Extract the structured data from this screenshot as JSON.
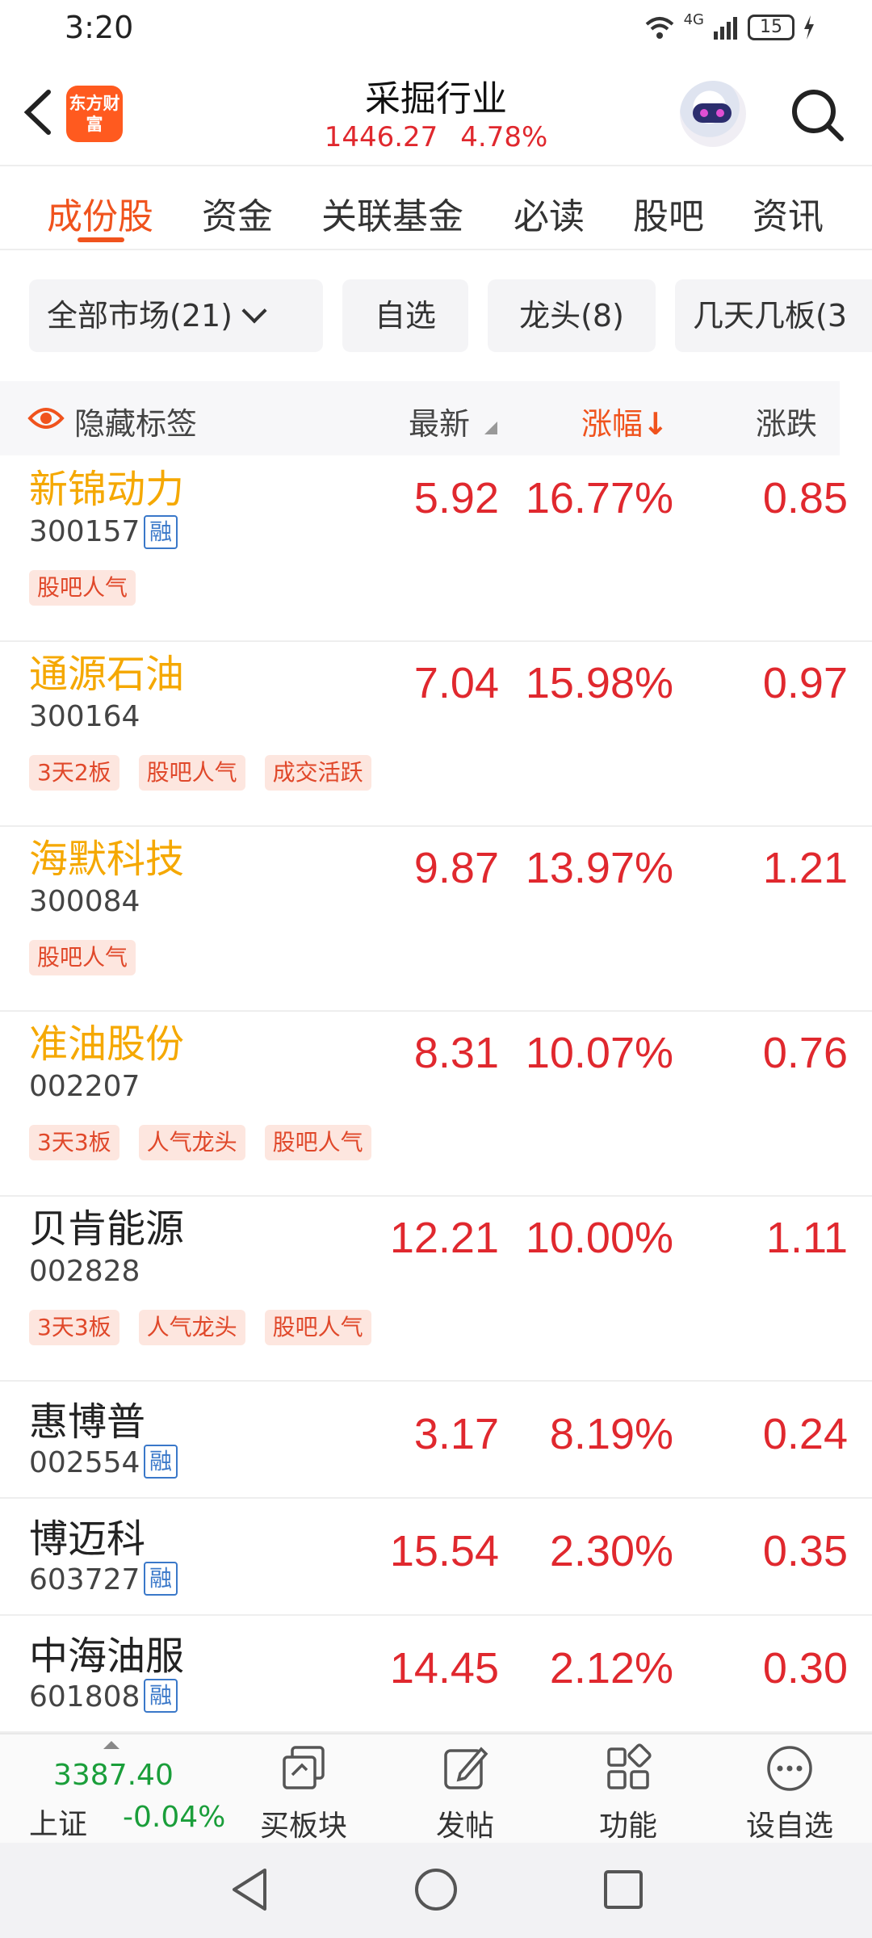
{
  "status_bar": {
    "time": "3:20",
    "network": "4G",
    "battery": "15"
  },
  "header": {
    "back_icon": "chevron-left-icon",
    "logo": "东方财富",
    "title": "采掘行业",
    "index_value": "1446.27",
    "index_change": "4.78%"
  },
  "tabs": [
    {
      "label": "成份股",
      "active": true
    },
    {
      "label": "资金"
    },
    {
      "label": "关联基金"
    },
    {
      "label": "必读"
    },
    {
      "label": "股吧"
    },
    {
      "label": "资讯"
    }
  ],
  "filters": [
    {
      "label": "全部市场(21)"
    },
    {
      "label": "自选"
    },
    {
      "label": "龙头(8)"
    },
    {
      "label": "几天几板(3"
    }
  ],
  "columns": {
    "hide_tags": "隐藏标签",
    "latest": "最新",
    "change_pct": "涨幅",
    "change_arrow": "↓",
    "change": "涨跌"
  },
  "rows": [
    {
      "name": "新锦动力",
      "code": "300157",
      "rong": "融",
      "latest": "5.92",
      "change_pct": "16.77%",
      "change": "0.85",
      "tags": [
        "股吧人气"
      ]
    },
    {
      "name": "通源石油",
      "code": "300164",
      "latest": "7.04",
      "change_pct": "15.98%",
      "change": "0.97",
      "tags": [
        "3天2板",
        "股吧人气",
        "成交活跃"
      ]
    },
    {
      "name": "海默科技",
      "code": "300084",
      "latest": "9.87",
      "change_pct": "13.97%",
      "change": "1.21",
      "tags": [
        "股吧人气"
      ]
    },
    {
      "name": "准油股份",
      "code": "002207",
      "latest": "8.31",
      "change_pct": "10.07%",
      "change": "0.76",
      "tags": [
        "3天3板",
        "人气龙头",
        "股吧人气"
      ]
    },
    {
      "name": "贝肯能源",
      "code": "002828",
      "latest": "12.21",
      "change_pct": "10.00%",
      "change": "1.11",
      "tags": [
        "3天3板",
        "人气龙头",
        "股吧人气"
      ]
    },
    {
      "name": "惠博普",
      "code": "002554",
      "rong": "融",
      "latest": "3.17",
      "change_pct": "8.19%",
      "change": "0.24"
    },
    {
      "name": "博迈科",
      "code": "603727",
      "rong": "融",
      "latest": "15.54",
      "change_pct": "2.30%",
      "change": "0.35"
    },
    {
      "name": "中海油服",
      "code": "601808",
      "rong": "融",
      "latest": "14.45",
      "change_pct": "2.12%",
      "change": "0.30"
    }
  ],
  "bottom_nav": {
    "index_value": "3387.40",
    "index_name": "上证",
    "index_change": "-0.04%",
    "items": [
      {
        "label": "买板块",
        "icon": "sector-icon"
      },
      {
        "label": "发帖",
        "icon": "edit-icon"
      },
      {
        "label": "功能",
        "icon": "grid-icon"
      },
      {
        "label": "设自选",
        "icon": "more-icon"
      }
    ]
  },
  "colors": {
    "accent": "#f0531d",
    "up": "#e0282e",
    "down": "#1a9e3a",
    "hot_name": "#f5a800"
  }
}
